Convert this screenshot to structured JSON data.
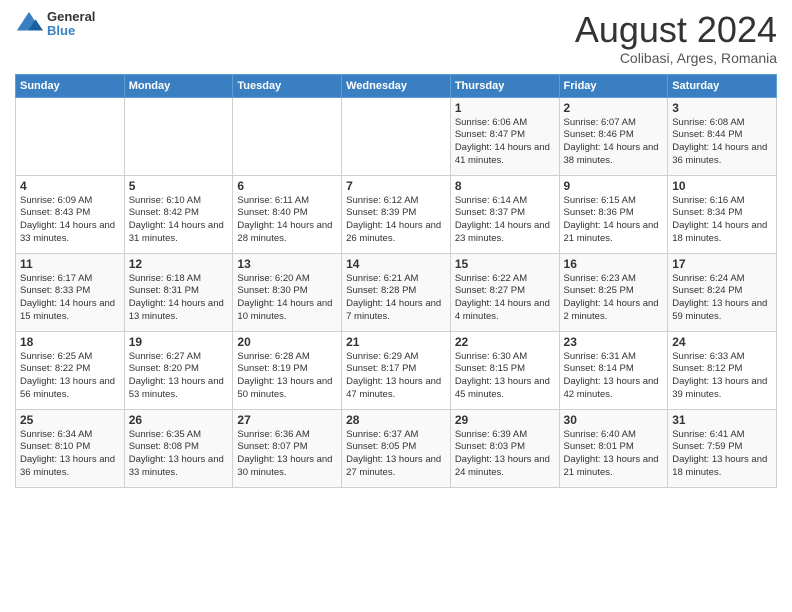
{
  "header": {
    "logo": {
      "general": "General",
      "blue": "Blue"
    },
    "title": "August 2024",
    "location": "Colibasi, Arges, Romania"
  },
  "days_of_week": [
    "Sunday",
    "Monday",
    "Tuesday",
    "Wednesday",
    "Thursday",
    "Friday",
    "Saturday"
  ],
  "weeks": [
    [
      {
        "day": "",
        "info": ""
      },
      {
        "day": "",
        "info": ""
      },
      {
        "day": "",
        "info": ""
      },
      {
        "day": "",
        "info": ""
      },
      {
        "day": "1",
        "info": "Sunrise: 6:06 AM\nSunset: 8:47 PM\nDaylight: 14 hours and 41 minutes."
      },
      {
        "day": "2",
        "info": "Sunrise: 6:07 AM\nSunset: 8:46 PM\nDaylight: 14 hours and 38 minutes."
      },
      {
        "day": "3",
        "info": "Sunrise: 6:08 AM\nSunset: 8:44 PM\nDaylight: 14 hours and 36 minutes."
      }
    ],
    [
      {
        "day": "4",
        "info": "Sunrise: 6:09 AM\nSunset: 8:43 PM\nDaylight: 14 hours and 33 minutes."
      },
      {
        "day": "5",
        "info": "Sunrise: 6:10 AM\nSunset: 8:42 PM\nDaylight: 14 hours and 31 minutes."
      },
      {
        "day": "6",
        "info": "Sunrise: 6:11 AM\nSunset: 8:40 PM\nDaylight: 14 hours and 28 minutes."
      },
      {
        "day": "7",
        "info": "Sunrise: 6:12 AM\nSunset: 8:39 PM\nDaylight: 14 hours and 26 minutes."
      },
      {
        "day": "8",
        "info": "Sunrise: 6:14 AM\nSunset: 8:37 PM\nDaylight: 14 hours and 23 minutes."
      },
      {
        "day": "9",
        "info": "Sunrise: 6:15 AM\nSunset: 8:36 PM\nDaylight: 14 hours and 21 minutes."
      },
      {
        "day": "10",
        "info": "Sunrise: 6:16 AM\nSunset: 8:34 PM\nDaylight: 14 hours and 18 minutes."
      }
    ],
    [
      {
        "day": "11",
        "info": "Sunrise: 6:17 AM\nSunset: 8:33 PM\nDaylight: 14 hours and 15 minutes."
      },
      {
        "day": "12",
        "info": "Sunrise: 6:18 AM\nSunset: 8:31 PM\nDaylight: 14 hours and 13 minutes."
      },
      {
        "day": "13",
        "info": "Sunrise: 6:20 AM\nSunset: 8:30 PM\nDaylight: 14 hours and 10 minutes."
      },
      {
        "day": "14",
        "info": "Sunrise: 6:21 AM\nSunset: 8:28 PM\nDaylight: 14 hours and 7 minutes."
      },
      {
        "day": "15",
        "info": "Sunrise: 6:22 AM\nSunset: 8:27 PM\nDaylight: 14 hours and 4 minutes."
      },
      {
        "day": "16",
        "info": "Sunrise: 6:23 AM\nSunset: 8:25 PM\nDaylight: 14 hours and 2 minutes."
      },
      {
        "day": "17",
        "info": "Sunrise: 6:24 AM\nSunset: 8:24 PM\nDaylight: 13 hours and 59 minutes."
      }
    ],
    [
      {
        "day": "18",
        "info": "Sunrise: 6:25 AM\nSunset: 8:22 PM\nDaylight: 13 hours and 56 minutes."
      },
      {
        "day": "19",
        "info": "Sunrise: 6:27 AM\nSunset: 8:20 PM\nDaylight: 13 hours and 53 minutes."
      },
      {
        "day": "20",
        "info": "Sunrise: 6:28 AM\nSunset: 8:19 PM\nDaylight: 13 hours and 50 minutes."
      },
      {
        "day": "21",
        "info": "Sunrise: 6:29 AM\nSunset: 8:17 PM\nDaylight: 13 hours and 47 minutes."
      },
      {
        "day": "22",
        "info": "Sunrise: 6:30 AM\nSunset: 8:15 PM\nDaylight: 13 hours and 45 minutes."
      },
      {
        "day": "23",
        "info": "Sunrise: 6:31 AM\nSunset: 8:14 PM\nDaylight: 13 hours and 42 minutes."
      },
      {
        "day": "24",
        "info": "Sunrise: 6:33 AM\nSunset: 8:12 PM\nDaylight: 13 hours and 39 minutes."
      }
    ],
    [
      {
        "day": "25",
        "info": "Sunrise: 6:34 AM\nSunset: 8:10 PM\nDaylight: 13 hours and 36 minutes."
      },
      {
        "day": "26",
        "info": "Sunrise: 6:35 AM\nSunset: 8:08 PM\nDaylight: 13 hours and 33 minutes."
      },
      {
        "day": "27",
        "info": "Sunrise: 6:36 AM\nSunset: 8:07 PM\nDaylight: 13 hours and 30 minutes."
      },
      {
        "day": "28",
        "info": "Sunrise: 6:37 AM\nSunset: 8:05 PM\nDaylight: 13 hours and 27 minutes."
      },
      {
        "day": "29",
        "info": "Sunrise: 6:39 AM\nSunset: 8:03 PM\nDaylight: 13 hours and 24 minutes."
      },
      {
        "day": "30",
        "info": "Sunrise: 6:40 AM\nSunset: 8:01 PM\nDaylight: 13 hours and 21 minutes."
      },
      {
        "day": "31",
        "info": "Sunrise: 6:41 AM\nSunset: 7:59 PM\nDaylight: 13 hours and 18 minutes."
      }
    ]
  ]
}
